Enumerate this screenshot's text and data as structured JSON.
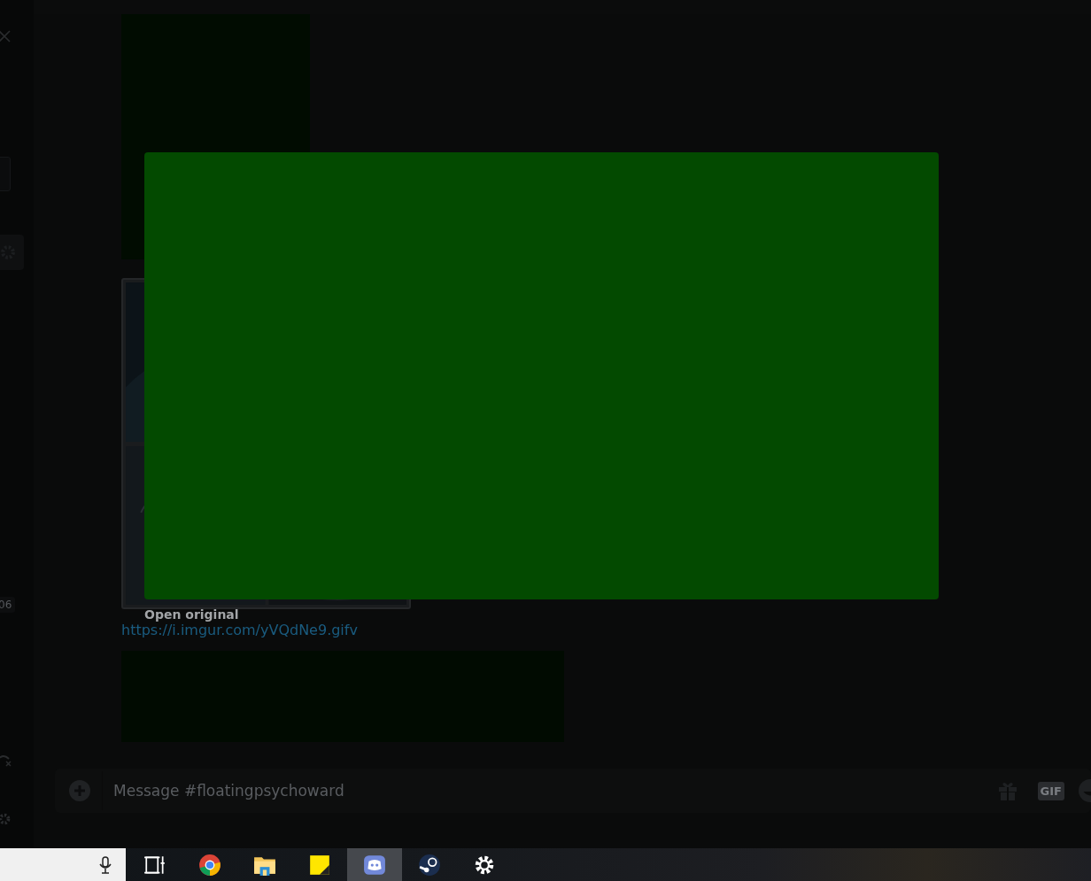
{
  "sidebar": {
    "badge": "06"
  },
  "messages": {
    "link": "https://i.imgur.com/yVQdNe9.gifv"
  },
  "composer": {
    "placeholder": "Message #floatingpsychoward",
    "gif_label": "GIF"
  },
  "modal": {
    "open_original": "Open original"
  },
  "taskbar": {
    "apps": [
      {
        "kind": "taskview",
        "selected": false
      },
      {
        "kind": "chrome",
        "selected": false
      },
      {
        "kind": "folder",
        "selected": false
      },
      {
        "kind": "sticky",
        "selected": false
      },
      {
        "kind": "discord",
        "selected": true
      },
      {
        "kind": "steam",
        "selected": false
      },
      {
        "kind": "settings",
        "selected": false
      }
    ]
  }
}
